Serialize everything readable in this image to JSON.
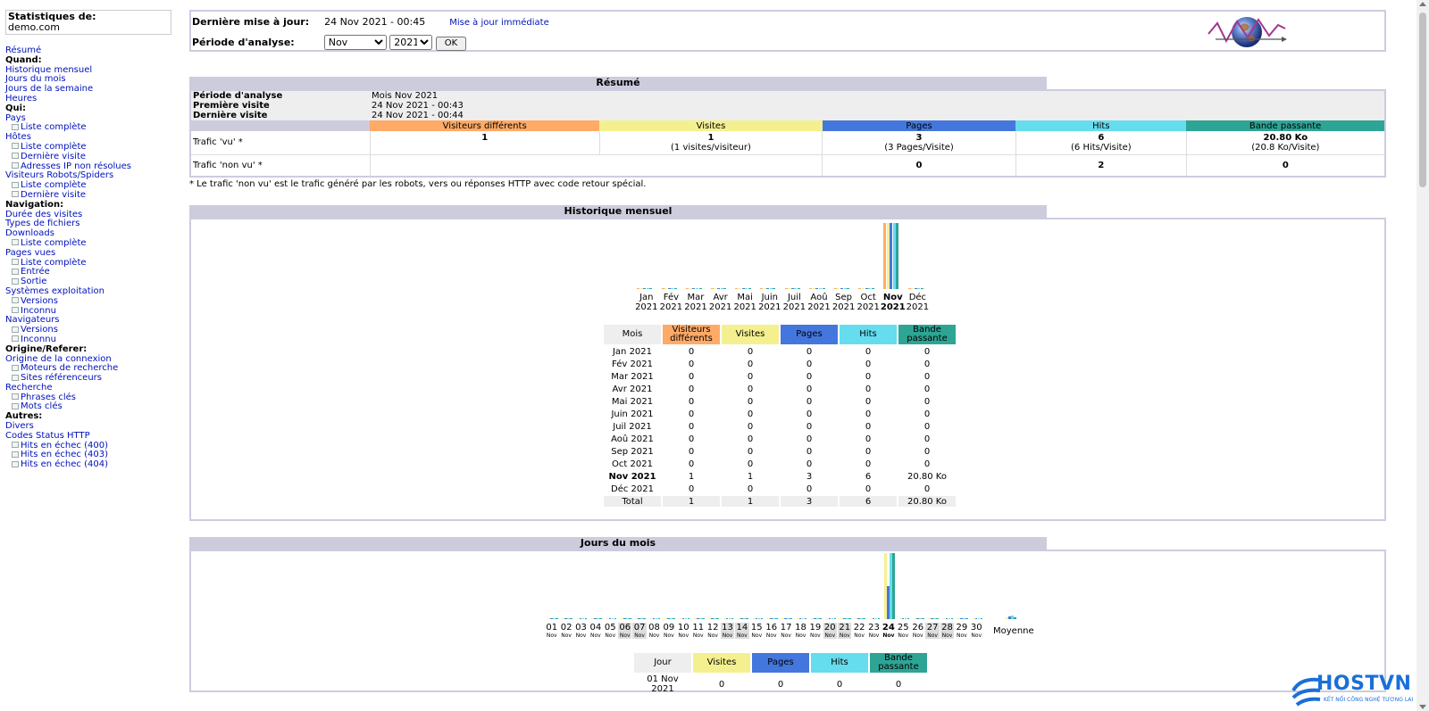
{
  "sidebar": {
    "title": "Statistiques de:",
    "site": "demo.com",
    "menu": [
      {
        "type": "link",
        "label": "Résumé"
      },
      {
        "type": "head",
        "label": "Quand:"
      },
      {
        "type": "link",
        "label": "Historique mensuel"
      },
      {
        "type": "link",
        "label": "Jours du mois"
      },
      {
        "type": "link",
        "label": "Jours de la semaine"
      },
      {
        "type": "link",
        "label": "Heures"
      },
      {
        "type": "head",
        "label": "Qui:"
      },
      {
        "type": "link",
        "label": "Pays"
      },
      {
        "type": "sub",
        "label": "Liste complète"
      },
      {
        "type": "link",
        "label": "Hôtes"
      },
      {
        "type": "sub",
        "label": "Liste complète"
      },
      {
        "type": "sub",
        "label": "Dernière visite"
      },
      {
        "type": "sub",
        "label": "Adresses IP non résolues"
      },
      {
        "type": "link",
        "label": "Visiteurs Robots/Spiders"
      },
      {
        "type": "sub",
        "label": "Liste complète"
      },
      {
        "type": "sub",
        "label": "Dernière visite"
      },
      {
        "type": "head",
        "label": "Navigation:"
      },
      {
        "type": "link",
        "label": "Durée des visites"
      },
      {
        "type": "link",
        "label": "Types de fichiers"
      },
      {
        "type": "link",
        "label": "Downloads"
      },
      {
        "type": "sub",
        "label": "Liste complète"
      },
      {
        "type": "link",
        "label": "Pages vues"
      },
      {
        "type": "sub",
        "label": "Liste complète"
      },
      {
        "type": "sub",
        "label": "Entrée"
      },
      {
        "type": "sub",
        "label": "Sortie"
      },
      {
        "type": "link",
        "label": "Systèmes exploitation"
      },
      {
        "type": "sub",
        "label": "Versions"
      },
      {
        "type": "sub",
        "label": "Inconnu"
      },
      {
        "type": "link",
        "label": "Navigateurs"
      },
      {
        "type": "sub",
        "label": "Versions"
      },
      {
        "type": "sub",
        "label": "Inconnu"
      },
      {
        "type": "head",
        "label": "Origine/Referer:"
      },
      {
        "type": "link",
        "label": "Origine de la connexion"
      },
      {
        "type": "sub",
        "label": "Moteurs de recherche"
      },
      {
        "type": "sub",
        "label": "Sites référenceurs"
      },
      {
        "type": "link",
        "label": "Recherche"
      },
      {
        "type": "sub",
        "label": "Phrases clés"
      },
      {
        "type": "sub",
        "label": "Mots clés"
      },
      {
        "type": "head",
        "label": "Autres:"
      },
      {
        "type": "link",
        "label": "Divers"
      },
      {
        "type": "link",
        "label": "Codes Status HTTP"
      },
      {
        "type": "sub",
        "label": "Hits en échec (400)"
      },
      {
        "type": "sub",
        "label": "Hits en échec (403)"
      },
      {
        "type": "sub",
        "label": "Hits en échec (404)"
      }
    ]
  },
  "top": {
    "last_update_label": "Dernière mise à jour:",
    "last_update_value": "24 Nov 2021 - 00:45",
    "update_now": "Mise à jour immédiate",
    "period_label": "Période d'analyse:",
    "month_selected": "Nov",
    "year_selected": "2021",
    "ok": "OK"
  },
  "colors": {
    "visitors": "#ffaa66",
    "visits": "#f4f090",
    "pages": "#4477dd",
    "hits": "#66ddee",
    "bandwidth": "#2ea495"
  },
  "summary": {
    "title": "Résumé",
    "period_label": "Période d'analyse",
    "period_value": "Mois Nov 2021",
    "first_label": "Première visite",
    "first_value": "24 Nov 2021 - 00:43",
    "last_label": "Dernière visite",
    "last_value": "24 Nov 2021 - 00:44",
    "col_visitors": "Visiteurs différents",
    "col_visits": "Visites",
    "col_pages": "Pages",
    "col_hits": "Hits",
    "col_bandwidth": "Bande passante",
    "seen_label": "Trafic 'vu' *",
    "seen": {
      "visitors": "1",
      "visits": "1",
      "visits_sub": "(1 visites/visiteur)",
      "pages": "3",
      "pages_sub": "(3 Pages/Visite)",
      "hits": "6",
      "hits_sub": "(6 Hits/Visite)",
      "bandwidth": "20.80 Ko",
      "bandwidth_sub": "(20.8 Ko/Visite)"
    },
    "unseen_label": "Trafic 'non vu' *",
    "unseen": {
      "pages": "0",
      "hits": "2",
      "bandwidth": "0"
    },
    "note": "* Le trafic 'non vu' est le trafic généré par les robots, vers ou réponses HTTP avec code retour spécial."
  },
  "monthly": {
    "title": "Historique mensuel",
    "col_month": "Mois",
    "col_visitors": "Visiteurs différents",
    "col_visits": "Visites",
    "col_pages": "Pages",
    "col_hits": "Hits",
    "col_bandwidth": "Bande passante",
    "rows": [
      {
        "m": "Jan",
        "y": "2021",
        "label": "Jan 2021",
        "v": "0",
        "vi": "0",
        "p": "0",
        "h": "0",
        "b": "0"
      },
      {
        "m": "Fév",
        "y": "2021",
        "label": "Fév 2021",
        "v": "0",
        "vi": "0",
        "p": "0",
        "h": "0",
        "b": "0"
      },
      {
        "m": "Mar",
        "y": "2021",
        "label": "Mar 2021",
        "v": "0",
        "vi": "0",
        "p": "0",
        "h": "0",
        "b": "0"
      },
      {
        "m": "Avr",
        "y": "2021",
        "label": "Avr 2021",
        "v": "0",
        "vi": "0",
        "p": "0",
        "h": "0",
        "b": "0"
      },
      {
        "m": "Mai",
        "y": "2021",
        "label": "Mai 2021",
        "v": "0",
        "vi": "0",
        "p": "0",
        "h": "0",
        "b": "0"
      },
      {
        "m": "Juin",
        "y": "2021",
        "label": "Juin 2021",
        "v": "0",
        "vi": "0",
        "p": "0",
        "h": "0",
        "b": "0"
      },
      {
        "m": "Juil",
        "y": "2021",
        "label": "Juil 2021",
        "v": "0",
        "vi": "0",
        "p": "0",
        "h": "0",
        "b": "0"
      },
      {
        "m": "Aoû",
        "y": "2021",
        "label": "Aoû 2021",
        "v": "0",
        "vi": "0",
        "p": "0",
        "h": "0",
        "b": "0"
      },
      {
        "m": "Sep",
        "y": "2021",
        "label": "Sep 2021",
        "v": "0",
        "vi": "0",
        "p": "0",
        "h": "0",
        "b": "0"
      },
      {
        "m": "Oct",
        "y": "2021",
        "label": "Oct 2021",
        "v": "0",
        "vi": "0",
        "p": "0",
        "h": "0",
        "b": "0"
      },
      {
        "m": "Nov",
        "y": "2021",
        "label": "Nov 2021",
        "v": "1",
        "vi": "1",
        "p": "3",
        "h": "6",
        "b": "20.80 Ko",
        "current": true
      },
      {
        "m": "Déc",
        "y": "2021",
        "label": "Déc 2021",
        "v": "0",
        "vi": "0",
        "p": "0",
        "h": "0",
        "b": "0"
      }
    ],
    "total": {
      "label": "Total",
      "v": "1",
      "vi": "1",
      "p": "3",
      "h": "6",
      "b": "20.80 Ko"
    }
  },
  "daily": {
    "title": "Jours du mois",
    "days": [
      "01",
      "02",
      "03",
      "04",
      "05",
      "06",
      "07",
      "08",
      "09",
      "10",
      "11",
      "12",
      "13",
      "14",
      "15",
      "16",
      "17",
      "18",
      "19",
      "20",
      "21",
      "22",
      "23",
      "24",
      "25",
      "26",
      "27",
      "28",
      "29",
      "30"
    ],
    "weekend": [
      "06",
      "07",
      "13",
      "14",
      "20",
      "21",
      "27",
      "28"
    ],
    "month_abbr": "Nov",
    "current_day": "24",
    "average_label": "Moyenne",
    "col_day": "Jour",
    "col_visits": "Visites",
    "col_pages": "Pages",
    "col_hits": "Hits",
    "col_bandwidth": "Bande passante",
    "first_row": {
      "day": "01 Nov 2021",
      "visits": "0",
      "pages": "0",
      "hits": "0",
      "bandwidth": "0"
    }
  },
  "watermark": {
    "brand": "HOSTVN",
    "tagline": "KẾT NỐI CÔNG NGHỆ TƯƠNG LAI"
  }
}
